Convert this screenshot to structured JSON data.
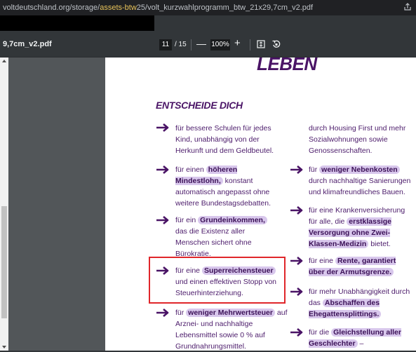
{
  "urlbar": {
    "url_pre": "voltdeutschland.org/storage/",
    "url_hl": "assets-btw",
    "url_post": "25/volt_kurzwahlprogramm_btw_21x29,7cm_v2.pdf"
  },
  "toolbar": {
    "filename": "9,7cm_v2.pdf",
    "page_current": "11",
    "page_total": "/ 15",
    "zoom_out": "—",
    "zoom": "100%",
    "zoom_in": "+"
  },
  "doc": {
    "title_fragment": "LEBEN",
    "heading": "ENTSCHEIDE DICH",
    "left": [
      {
        "pre": "für bessere Schulen für jedes Kind, unabhängig von der Herkunft und dem Geldbeutel.",
        "hl": "",
        "post": ""
      },
      {
        "pre": "für einen ",
        "hl": "höheren Mindestlohn,",
        "post": " konstant automatisch angepasst ohne weitere Bundestagsdebatten."
      },
      {
        "pre": "für ein ",
        "hl": "Grundeinkommen,",
        "post": " das die Existenz aller Menschen sichert ohne Bürokratie."
      },
      {
        "pre": "für eine ",
        "hl": "Superreichensteuer",
        "post": " und einen effektiven Stopp von Steuerhinterziehung."
      },
      {
        "pre": "für ",
        "hl": "weniger Mehrwertsteuer",
        "post": " auf Arznei- und nachhaltige Lebensmittel sowie 0 % auf Grundnahrungsmittel."
      }
    ],
    "right": [
      {
        "pre": "durch Housing First und mehr Sozialwohnungen sowie Genossenschaften.",
        "hl": "",
        "post": ""
      },
      {
        "pre": "für ",
        "hl": "weniger Nebenkosten",
        "post": " durch  nachhaltige Sanierungen und klimafreundliches Bauen."
      },
      {
        "pre": "für eine Krankenversicherung für alle, die ",
        "hl": "erstklassige Versorgung ohne Zwei-Klassen-Medizin",
        "post": " bietet."
      },
      {
        "pre": "für eine ",
        "hl": "Rente, garantiert über der Armutsgrenze.",
        "post": ""
      },
      {
        "pre": "für mehr Unabhängigkeit durch das ",
        "hl": "Abschaffen des Ehegattensplittings.",
        "post": ""
      },
      {
        "pre": "für die ",
        "hl": "Gleichstellung aller Geschlechter",
        "post": " –"
      }
    ]
  }
}
